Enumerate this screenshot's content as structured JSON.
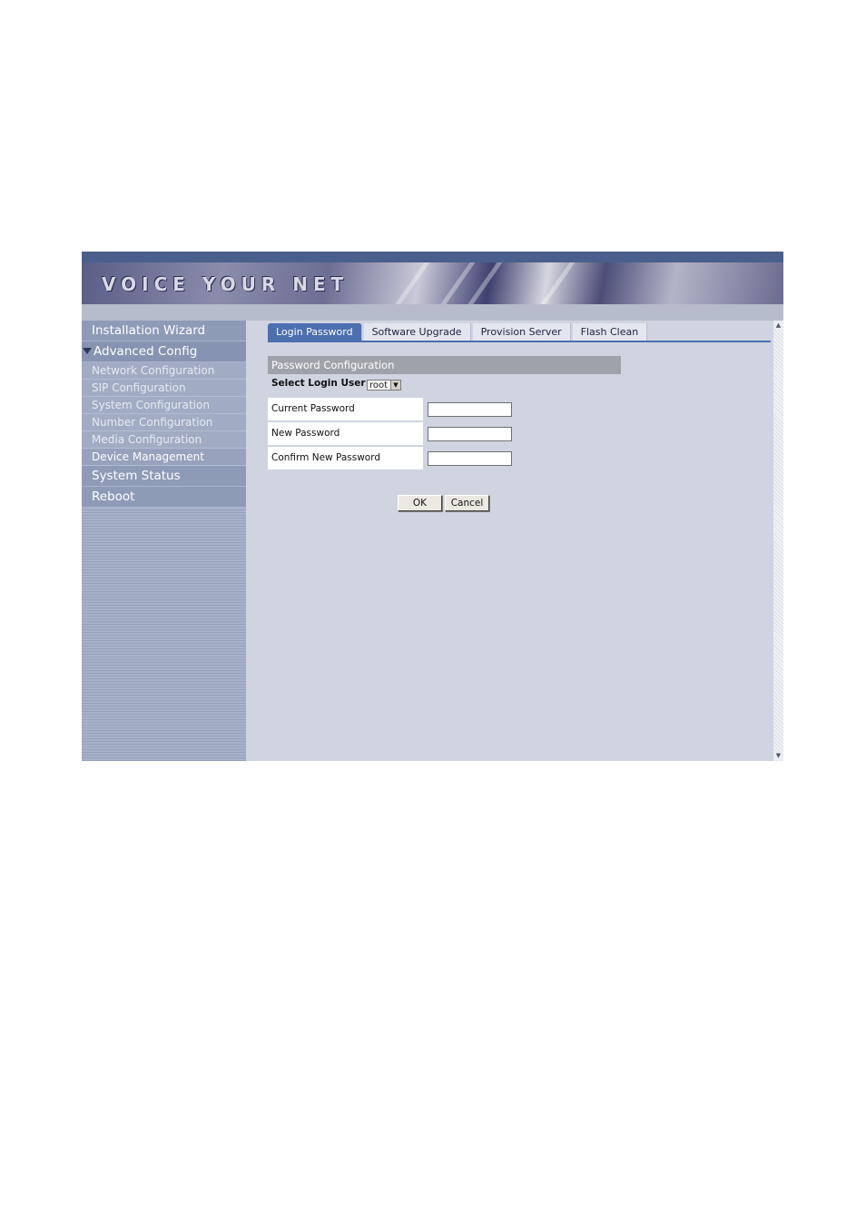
{
  "banner": {
    "title": "VOICE YOUR NET"
  },
  "sidebar": {
    "items": [
      {
        "label": "Installation Wizard"
      },
      {
        "label": "Advanced Config"
      },
      {
        "label": "Network Configuration"
      },
      {
        "label": "SIP Configuration"
      },
      {
        "label": "System Configuration"
      },
      {
        "label": "Number Configuration"
      },
      {
        "label": "Media Configuration"
      },
      {
        "label": "Device Management"
      },
      {
        "label": "System Status"
      },
      {
        "label": "Reboot"
      }
    ]
  },
  "tabs": [
    {
      "label": "Login Password",
      "active": true
    },
    {
      "label": "Software Upgrade"
    },
    {
      "label": "Provision Server"
    },
    {
      "label": "Flash Clean"
    }
  ],
  "form": {
    "section_title": "Password Configuration",
    "select_label": "Select Login User :",
    "select_value": "root",
    "fields": [
      {
        "label": "Current Password",
        "value": ""
      },
      {
        "label": "New Password",
        "value": ""
      },
      {
        "label": "Confirm New Password",
        "value": ""
      }
    ],
    "ok_label": "OK",
    "cancel_label": "Cancel"
  },
  "colors": {
    "tab_active": "#4c6fb0",
    "sidebar": "#8e9bb7",
    "content_bg": "#d0d4e0",
    "section_header": "#9fa2a9"
  }
}
